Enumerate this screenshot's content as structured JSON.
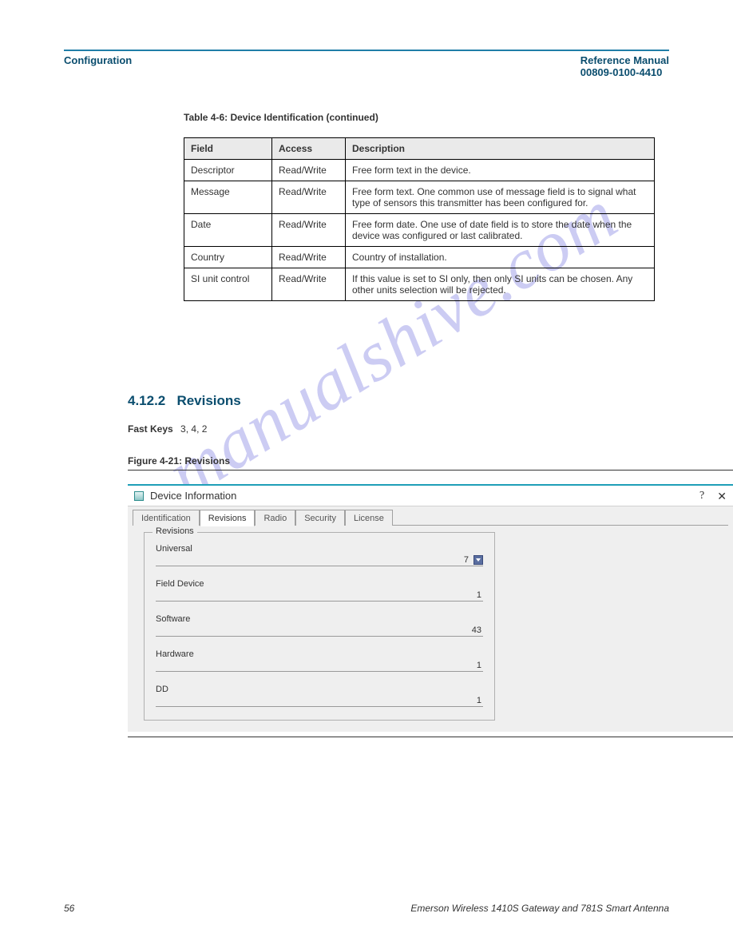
{
  "header": {
    "left": "Configuration",
    "right": "Reference Manual",
    "subright": "00809-0100-4410"
  },
  "table": {
    "caption": "Table 4-6: Device Identification (continued)",
    "headers": [
      "Field",
      "Access",
      "Description"
    ],
    "rows": [
      [
        "Descriptor",
        "Read/Write",
        "Free form text in the device."
      ],
      [
        "Message",
        "Read/Write",
        "Free form text. One common use of message field is to signal what type of sensors this transmitter has been configured for."
      ],
      [
        "Date",
        "Read/Write",
        "Free form date. One use of date field is to store the date when the device was configured or last calibrated."
      ],
      [
        "Country",
        "Read/Write",
        "Country of installation."
      ],
      [
        "SI unit control",
        "Read/Write",
        "If this value is set to SI only, then only SI units can be chosen. Any other units selection will be rejected."
      ]
    ]
  },
  "section": {
    "number": "4.12.2",
    "title": "Revisions"
  },
  "fastkeys": {
    "label": "Fast Keys",
    "value": "3, 4, 2"
  },
  "figure": {
    "caption": "Figure 4-21: Revisions"
  },
  "dialog": {
    "title": "Device Information",
    "tabs": [
      "Identification",
      "Revisions",
      "Radio",
      "Security",
      "License"
    ],
    "active_tab": 1,
    "group_legend": "Revisions",
    "fields": [
      {
        "label": "Universal",
        "value": "7",
        "dropdown": true
      },
      {
        "label": "Field Device",
        "value": "1",
        "dropdown": false
      },
      {
        "label": "Software",
        "value": "43",
        "dropdown": false
      },
      {
        "label": "Hardware",
        "value": "1",
        "dropdown": false
      },
      {
        "label": "DD",
        "value": "1",
        "dropdown": false
      }
    ]
  },
  "footer": {
    "page": "56",
    "doc": "Emerson Wireless 1410S Gateway and 781S Smart Antenna"
  },
  "watermark": "manualshive.com"
}
